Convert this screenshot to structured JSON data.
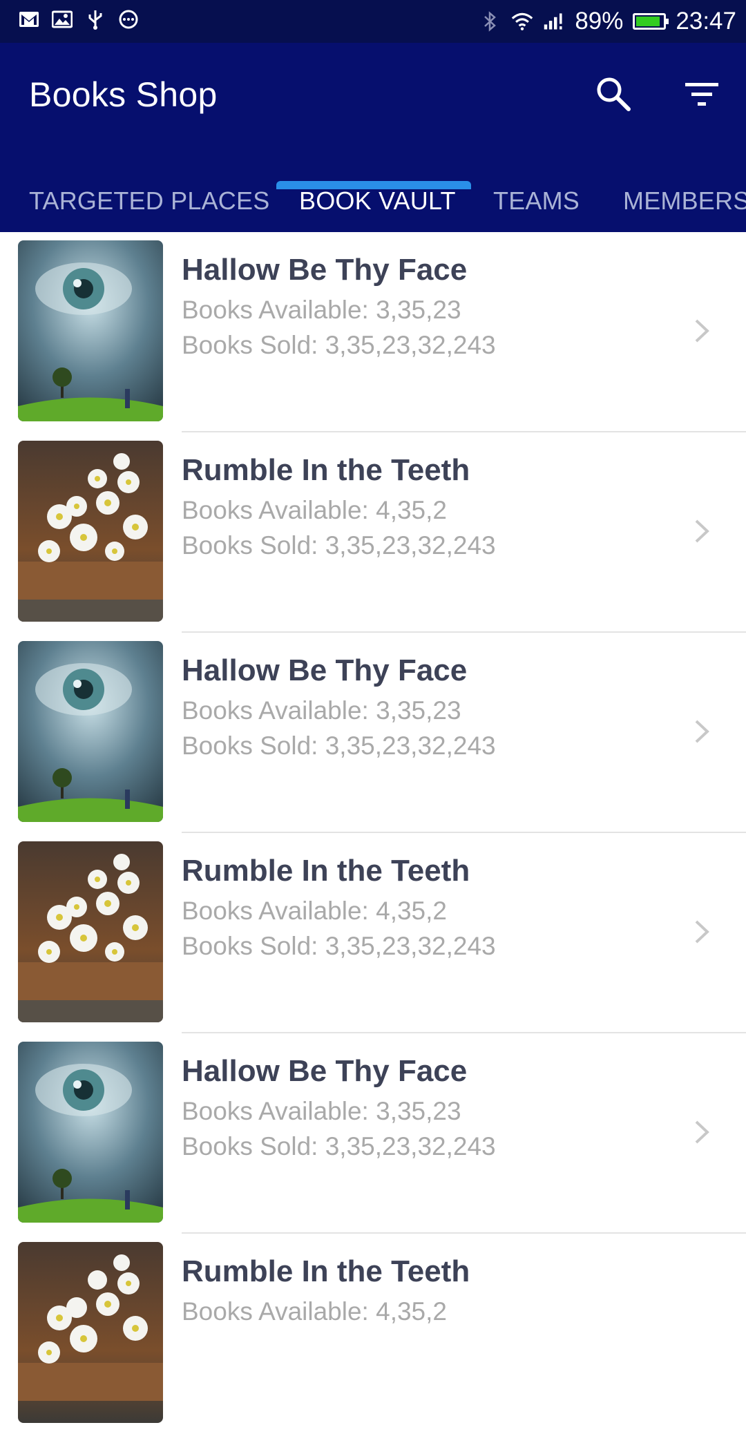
{
  "status_bar": {
    "battery_percent": "89%",
    "battery_level": 0.89,
    "time": "23:47",
    "icons": [
      "gmail-icon",
      "image-icon",
      "usb-icon",
      "more-icon",
      "bluetooth-icon",
      "wifi-icon",
      "signal-icon",
      "battery-icon"
    ]
  },
  "app_bar": {
    "title": "Books Shop",
    "actions": [
      "search-icon",
      "filter-icon"
    ]
  },
  "tabs": [
    {
      "label": "TARGETED PLACES",
      "active": false
    },
    {
      "label": "BOOK VAULT",
      "active": true
    },
    {
      "label": "TEAMS",
      "active": false
    },
    {
      "label": "MEMBERS",
      "active": false
    }
  ],
  "colors": {
    "status_bar": "#060f4f",
    "app_bar": "#060f6e",
    "tab_indicator": "#2a8fe8",
    "title_text": "#3d4257",
    "secondary_text": "#a9a9a9"
  },
  "books": [
    {
      "title": "Hallow Be Thy Face",
      "available": "Books Available: 3,35,23",
      "sold": "Books Sold: 3,35,23,32,243",
      "cover": "eye-cover"
    },
    {
      "title": "Rumble In the Teeth",
      "available": "Books Available: 4,35,2",
      "sold": "Books Sold: 3,35,23,32,243",
      "cover": "flowers-cover"
    },
    {
      "title": "Hallow Be Thy Face",
      "available": "Books Available: 3,35,23",
      "sold": "Books Sold: 3,35,23,32,243",
      "cover": "eye-cover"
    },
    {
      "title": "Rumble In the Teeth",
      "available": "Books Available: 4,35,2",
      "sold": "Books Sold: 3,35,23,32,243",
      "cover": "flowers-cover"
    },
    {
      "title": "Hallow Be Thy Face",
      "available": "Books Available: 3,35,23",
      "sold": "Books Sold: 3,35,23,32,243",
      "cover": "eye-cover"
    },
    {
      "title": "Rumble In the Teeth",
      "available": "Books Available: 4,35,2",
      "sold": "",
      "cover": "flowers-cover"
    }
  ]
}
